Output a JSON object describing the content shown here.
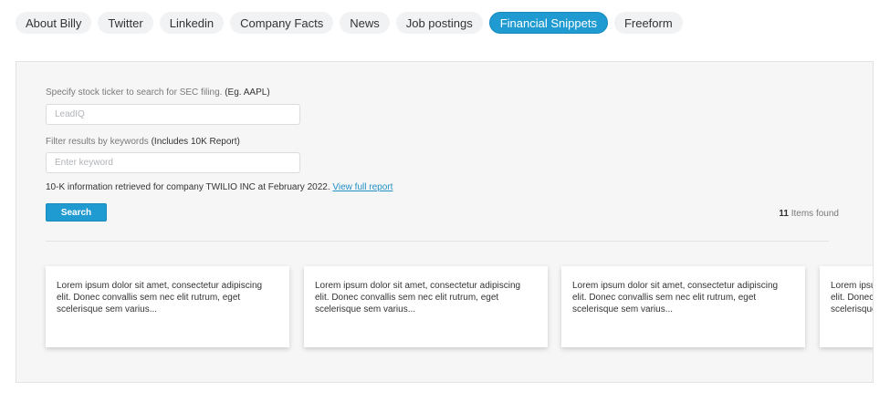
{
  "tabs": [
    {
      "label": "About Billy",
      "active": false
    },
    {
      "label": "Twitter",
      "active": false
    },
    {
      "label": "Linkedin",
      "active": false
    },
    {
      "label": "Company Facts",
      "active": false
    },
    {
      "label": "News",
      "active": false
    },
    {
      "label": "Job postings",
      "active": false
    },
    {
      "label": "Financial Snippets",
      "active": true
    },
    {
      "label": "Freeform",
      "active": false
    }
  ],
  "form": {
    "ticker_label": "Specify stock ticker to search for SEC filing.",
    "ticker_label_example": "(Eg. AAPL)",
    "ticker_placeholder": "LeadIQ",
    "keyword_label": "Filter results by keywords",
    "keyword_label_note": "(Includes 10K Report)",
    "keyword_placeholder": "Enter keyword",
    "info_text": "10-K information retrieved for company TWILIO INC at February 2022.",
    "info_link": "View full report",
    "search_label": "Search"
  },
  "results": {
    "count": "11",
    "count_suffix": "Items found"
  },
  "cards": [
    {
      "text": "Lorem ipsum dolor sit amet, consectetur adipiscing elit. Donec convallis sem nec elit rutrum, eget scelerisque sem varius..."
    },
    {
      "text": "Lorem ipsum dolor sit amet, consectetur adipiscing elit. Donec convallis sem nec elit rutrum, eget scelerisque sem varius..."
    },
    {
      "text": "Lorem ipsum dolor sit amet, consectetur adipiscing elit. Donec convallis sem nec elit rutrum, eget scelerisque sem varius..."
    },
    {
      "text": "Lorem ipsum dolor sit amet, consectetur adipiscing elit. Donec convallis sem nec elit rutrum, eget scelerisque sem varius..."
    }
  ],
  "colors": {
    "accent": "#1f9bd1",
    "panel_bg": "#f6f6f6",
    "tab_bg": "#f1f2f4"
  }
}
